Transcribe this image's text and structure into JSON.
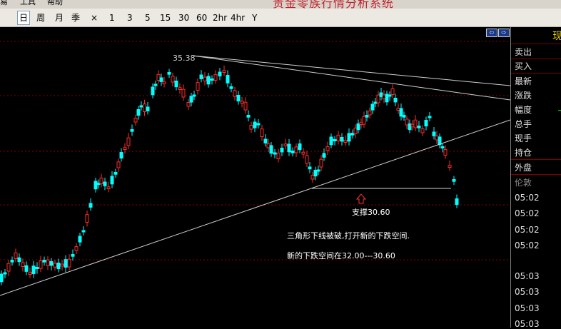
{
  "menu": {
    "items": [
      "易",
      "工具",
      "帮助"
    ]
  },
  "app_title": "贵金零族行情分析系统",
  "toolbar": {
    "periods": [
      "日",
      "周",
      "月",
      "季",
      "×",
      "1",
      "3",
      "5",
      "15",
      "30",
      "60",
      "2hr",
      "4hr",
      "Y"
    ],
    "selected": "日"
  },
  "chart": {
    "high_label": "35.38",
    "support_label": "支撑30.60",
    "annotation_line1": "三角形下线被破,打开新的下跌空间.",
    "annotation_line2": "新的下跌空间在32.00---30.60"
  },
  "chart_data": {
    "type": "candlestick",
    "annotations": [
      "35.38",
      "支撑30.60"
    ],
    "support_level": 30.6,
    "target_range": [
      32.0,
      30.6
    ],
    "colors": {
      "up": "#ff2a2a",
      "down": "#00ffff",
      "trendline": "#d0d0d0"
    }
  },
  "right_panel": {
    "top_label": "现",
    "labels": [
      "卖出",
      "买入",
      "最新",
      "涨跌",
      "幅度",
      "总手",
      "现手",
      "持仓",
      "外盘"
    ],
    "column_header": "伦敦",
    "times": [
      "05:02",
      "05:02",
      "05:02",
      "05:02",
      "05:03",
      "05:03",
      "05:03",
      "05:03"
    ]
  },
  "nav": {
    "left": "⇦",
    "right": "⇨"
  }
}
